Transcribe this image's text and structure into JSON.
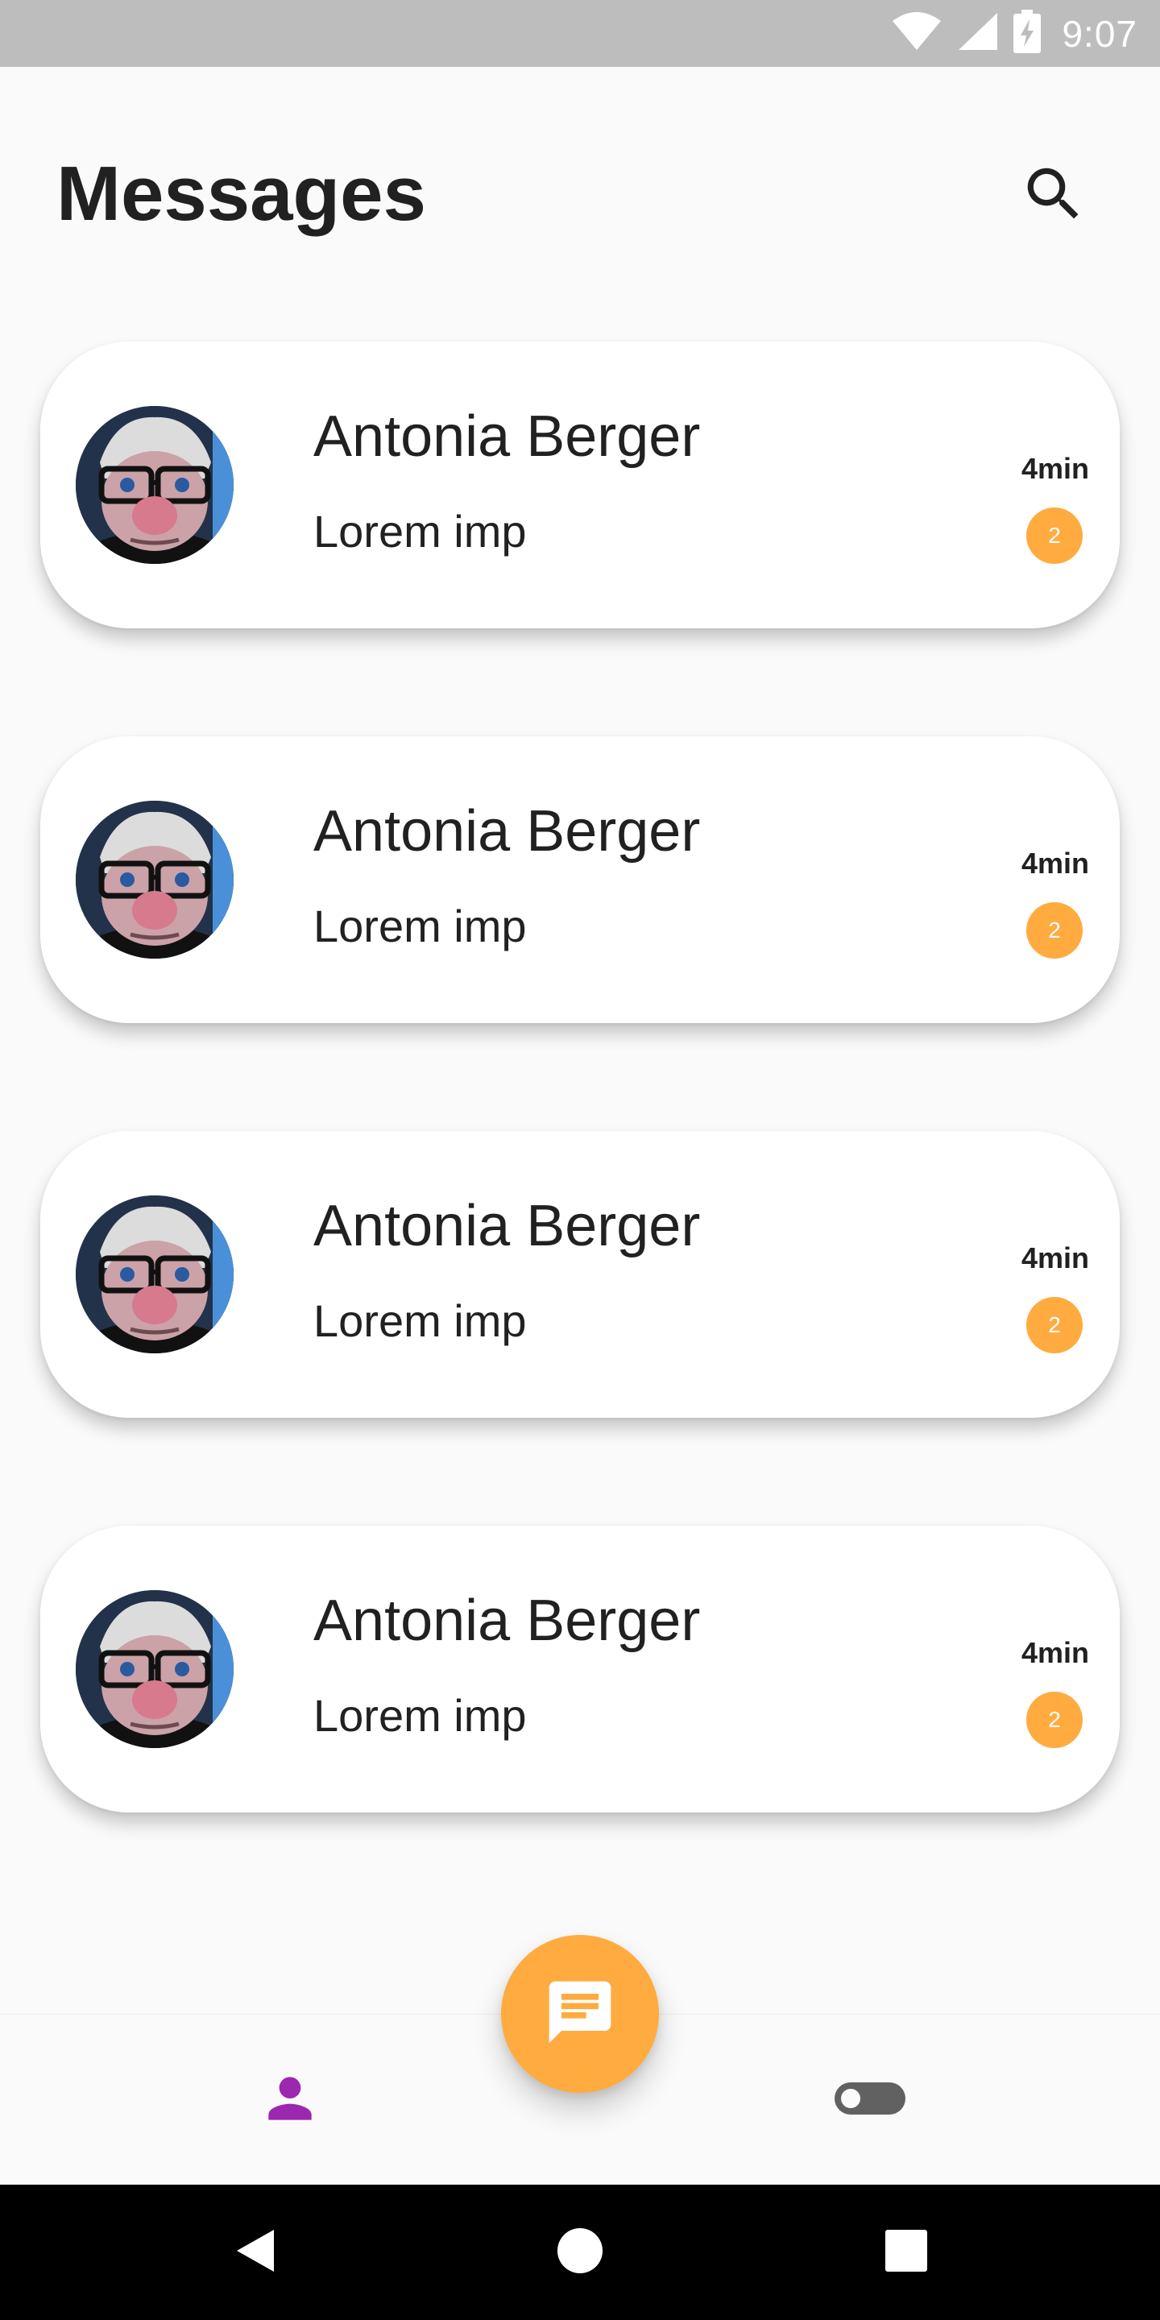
{
  "status_bar": {
    "time": "9:07",
    "icons": [
      "wifi-icon",
      "cellular-signal-icon",
      "battery-charging-icon"
    ]
  },
  "header": {
    "title": "Messages",
    "search_icon": "search-icon"
  },
  "conversations": [
    {
      "name": "Antonia Berger",
      "preview": "Lorem imp",
      "time": "4min",
      "unread": "2"
    },
    {
      "name": "Antonia Berger",
      "preview": "Lorem imp",
      "time": "4min",
      "unread": "2"
    },
    {
      "name": "Antonia Berger",
      "preview": "Lorem imp",
      "time": "4min",
      "unread": "2"
    },
    {
      "name": "Antonia Berger",
      "preview": "Lorem imp",
      "time": "4min",
      "unread": "2"
    }
  ],
  "bottom_nav": {
    "items": [
      {
        "icon": "person-icon",
        "active": true
      },
      {
        "icon": "toggle-icon",
        "active": false
      }
    ],
    "fab_icon": "chat-message-icon"
  },
  "system_nav": [
    "back-icon",
    "home-icon",
    "recents-icon"
  ],
  "colors": {
    "accent": "#ffab40",
    "active_nav": "#9c27b0",
    "inactive_nav": "#616161",
    "status_bar": "#bdbdbd",
    "background": "#fafafa",
    "text": "#212121"
  }
}
